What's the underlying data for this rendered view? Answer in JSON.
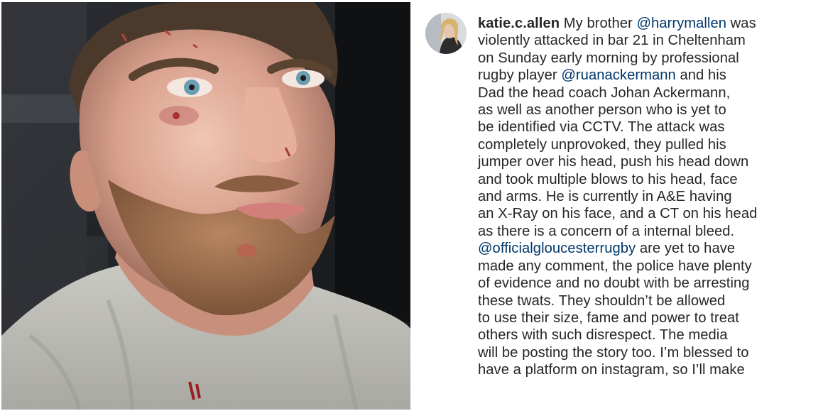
{
  "post": {
    "username": "katie.c.allen",
    "caption_lines": [
      [
        {
          "t": "My brother ",
          "k": "text"
        },
        {
          "t": "@harrymallen",
          "k": "mention"
        },
        {
          "t": " was",
          "k": "text"
        }
      ],
      [
        {
          "t": "violently attacked in bar 21 in Cheltenham",
          "k": "text"
        }
      ],
      [
        {
          "t": "on Sunday early morning by professional",
          "k": "text"
        }
      ],
      [
        {
          "t": "rugby player ",
          "k": "text"
        },
        {
          "t": "@ruanackermann",
          "k": "mention"
        },
        {
          "t": " and his",
          "k": "text"
        }
      ],
      [
        {
          "t": "Dad the head coach Johan Ackermann,",
          "k": "text"
        }
      ],
      [
        {
          "t": "as well as another person who is yet to",
          "k": "text"
        }
      ],
      [
        {
          "t": "be identified via CCTV. The attack was",
          "k": "text"
        }
      ],
      [
        {
          "t": "completely unprovoked, they pulled his",
          "k": "text"
        }
      ],
      [
        {
          "t": "jumper over his head, push his head down",
          "k": "text"
        }
      ],
      [
        {
          "t": "and took multiple blows to his head, face",
          "k": "text"
        }
      ],
      [
        {
          "t": "and arms. He is currently in A&E having",
          "k": "text"
        }
      ],
      [
        {
          "t": "an X-Ray on his face, and a CT on his head",
          "k": "text"
        }
      ],
      [
        {
          "t": "as there is a concern of a internal bleed.",
          "k": "text"
        }
      ],
      [
        {
          "t": "@officialgloucesterrugby",
          "k": "mention"
        },
        {
          "t": " are yet to have",
          "k": "text"
        }
      ],
      [
        {
          "t": "made any comment, the police have plenty",
          "k": "text"
        }
      ],
      [
        {
          "t": "of evidence and no doubt with be arresting",
          "k": "text"
        }
      ],
      [
        {
          "t": "these twats. They shouldn’t be allowed",
          "k": "text"
        }
      ],
      [
        {
          "t": "to use their size, fame and power to treat",
          "k": "text"
        }
      ],
      [
        {
          "t": "others with such disrespect. The media",
          "k": "text"
        }
      ],
      [
        {
          "t": "will be posting the story too. I’m blessed to",
          "k": "text"
        }
      ],
      [
        {
          "t": "have a platform on instagram, so I’ll make",
          "k": "text"
        }
      ]
    ]
  },
  "colors": {
    "text": "#262626",
    "mention": "#00376b",
    "background": "#ffffff"
  }
}
